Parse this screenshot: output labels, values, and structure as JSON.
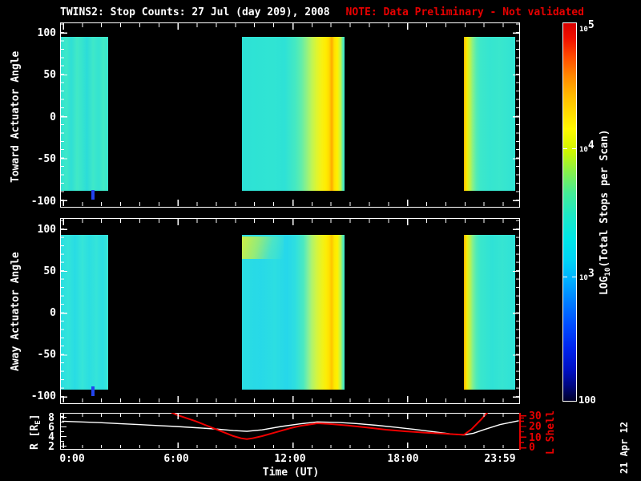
{
  "title": {
    "main": "TWINS2: Stop Counts: 27 Jul (day 209), 2008",
    "note": "NOTE: Data Preliminary - Not validated"
  },
  "colors": {
    "background": "#000000",
    "foreground": "#ffffff",
    "alert_red": "#e60000",
    "r_line": "#ffffff",
    "l_line": "#ee0000",
    "spectro_cyan": "#33e5d2",
    "spectro_yellow": "#ffe800",
    "notch_blue": "#2244ee"
  },
  "xaxis": {
    "label": "Time (UT)",
    "tick_labels": [
      "0:00",
      "6:00",
      "12:00",
      "18:00",
      "23:59"
    ],
    "tick_hours": [
      0,
      6,
      12,
      18,
      23.983
    ],
    "minor_tick_interval_hours": 1
  },
  "panels": {
    "toward": {
      "ylabel": "Toward Actuator Angle",
      "ytick_labels": [
        "100",
        "50",
        "0",
        "-50",
        "-100"
      ],
      "ylim": [
        -110,
        110
      ]
    },
    "away": {
      "ylabel": "Away Actuator Angle",
      "ytick_labels": [
        "100",
        "50",
        "0",
        "-50",
        "-100"
      ],
      "ylim": [
        -110,
        110
      ]
    },
    "bottom": {
      "left_label": {
        "pre": "R [R",
        "sub": "E",
        "post": "]"
      },
      "left_tick_labels": [
        "8",
        "6",
        "4",
        "2"
      ],
      "right_label": "L Shell",
      "right_tick_labels": [
        "30",
        "20",
        "10",
        "0"
      ]
    }
  },
  "colorbar": {
    "label": {
      "pre": "LOG",
      "sub": "10",
      "post": "(Total Stops per Scan)"
    },
    "ticks": [
      {
        "base": "10",
        "sup": "5"
      },
      {
        "base": "10",
        "sup": "4"
      },
      {
        "base": "10",
        "sup": "3"
      },
      {
        "base": "100",
        "sup": ""
      }
    ],
    "scale_log_range": [
      2,
      5
    ],
    "gradient": [
      [
        "0%",
        "#d80000"
      ],
      [
        "4%",
        "#f01000"
      ],
      [
        "9%",
        "#ff4c00"
      ],
      [
        "14%",
        "#ff8800"
      ],
      [
        "19%",
        "#ffb800"
      ],
      [
        "24%",
        "#ffdc00"
      ],
      [
        "28%",
        "#fff800"
      ],
      [
        "34%",
        "#ccf600"
      ],
      [
        "39%",
        "#8af046"
      ],
      [
        "45%",
        "#44ec96"
      ],
      [
        "51%",
        "#1ce8c6"
      ],
      [
        "57%",
        "#00e6e6"
      ],
      [
        "63%",
        "#00d2f6"
      ],
      [
        "68%",
        "#00b0ff"
      ],
      [
        "74%",
        "#007cff"
      ],
      [
        "80%",
        "#004cff"
      ],
      [
        "86%",
        "#0024ee"
      ],
      [
        "92%",
        "#000fc0"
      ],
      [
        "96%",
        "#000780"
      ],
      [
        "100%",
        "#000028"
      ]
    ]
  },
  "date_stamp": "21 Apr 12",
  "chart_data": [
    {
      "type": "heatmap",
      "title": "Toward Actuator Angle stop counts spectrogram",
      "xlabel": "Time (UT)",
      "ylabel": "Toward Actuator Angle",
      "xlim_hours": [
        0,
        24
      ],
      "ylim": [
        -110,
        110
      ],
      "zlabel": "LOG10(Total Stops per Scan)",
      "zlim_log10": [
        2,
        5
      ],
      "segments": [
        {
          "t_start": 0.0,
          "t_end": 2.4,
          "angle_range": [
            -92,
            92
          ],
          "description": "uniform cyan ~10^3.3-10^3.5 counts; narrow dark-blue notch (~10^2.6) at bottom edge near t=1.55h"
        },
        {
          "t_start": 9.45,
          "t_end": 14.85,
          "angle_range": [
            -92,
            92
          ],
          "description": "cyan ~10^3.4 until ~12.5h, rising through green/yellow; bright yellow band ~10^4.2-10^4.4 (orange streaks ~10^4.5) at 13.8-14.6h, back to cyan at right edge"
        },
        {
          "t_start": 21.1,
          "t_end": 23.8,
          "angle_range": [
            -92,
            92
          ],
          "description": "yellow-orange edge ~10^4.2 at 21.1-21.3h decaying to uniform cyan ~10^3.4 by 22h"
        }
      ]
    },
    {
      "type": "heatmap",
      "title": "Away Actuator Angle stop counts spectrogram",
      "xlabel": "Time (UT)",
      "ylabel": "Away Actuator Angle",
      "xlim_hours": [
        0,
        24
      ],
      "ylim": [
        -110,
        110
      ],
      "zlabel": "LOG10(Total Stops per Scan)",
      "zlim_log10": [
        2,
        5
      ],
      "segments": [
        {
          "t_start": 0.0,
          "t_end": 2.4,
          "angle_range": [
            -92,
            92
          ],
          "description": "uniform blue-cyan ~10^3.3; dark-blue notch at bottom edge near t=1.55h"
        },
        {
          "t_start": 9.45,
          "t_end": 14.85,
          "angle_range": [
            -92,
            92
          ],
          "description": "blue-cyan ~10^3.2-10^3.4; green-yellow patch ~10^3.9 at angles 55..90 during 9.5-11h; yellow band ~10^4.2 at 13.8-14.6h"
        },
        {
          "t_start": 21.1,
          "t_end": 23.8,
          "angle_range": [
            -92,
            92
          ],
          "description": "yellow-orange edge ~10^4.2 at 21.1h fading to cyan ~10^3.3"
        }
      ]
    },
    {
      "type": "line",
      "title": "Spacecraft radial distance and L shell",
      "xlabel": "Time (UT)",
      "xlim_hours": [
        0,
        24
      ],
      "ylim_left": [
        2,
        8
      ],
      "ylim_right": [
        0,
        30
      ],
      "series": [
        {
          "name": "R [RE]",
          "axis": "left",
          "color": "#ffffff",
          "x_hours": [
            0,
            1,
            2,
            3,
            4,
            5,
            6,
            7,
            8,
            9,
            9.7,
            10.5,
            11.5,
            12.5,
            13.4,
            14.5,
            15.5,
            16.5,
            17.5,
            18.5,
            19.5,
            20.5,
            21.1,
            21.6,
            22.2,
            23,
            23.98
          ],
          "values": [
            7.1,
            6.95,
            6.8,
            6.6,
            6.4,
            6.2,
            6.0,
            5.75,
            5.5,
            5.15,
            5.0,
            5.3,
            6.0,
            6.55,
            6.95,
            6.85,
            6.6,
            6.25,
            5.85,
            5.4,
            4.9,
            4.4,
            4.25,
            4.6,
            5.4,
            6.4,
            7.2
          ]
        },
        {
          "name": "L Shell",
          "axis": "right",
          "color": "#ee0000",
          "x_hours": [
            5.7,
            6,
            6.5,
            7,
            7.5,
            8,
            8.5,
            9,
            9.4,
            9.7,
            10,
            10.5,
            11,
            11.5,
            12,
            12.5,
            13.4,
            14,
            15,
            16,
            17,
            18,
            19,
            20,
            20.6,
            21.1,
            21.5,
            22,
            22.35
          ],
          "values": [
            33,
            30.5,
            27.5,
            24.5,
            21,
            17.5,
            14,
            10.5,
            8.5,
            7.7,
            8.5,
            10.5,
            13,
            15.5,
            18,
            20,
            22.5,
            22,
            20.5,
            18.5,
            16.5,
            15,
            13.8,
            12.8,
            12.2,
            11.8,
            17,
            26,
            33
          ]
        }
      ]
    }
  ]
}
